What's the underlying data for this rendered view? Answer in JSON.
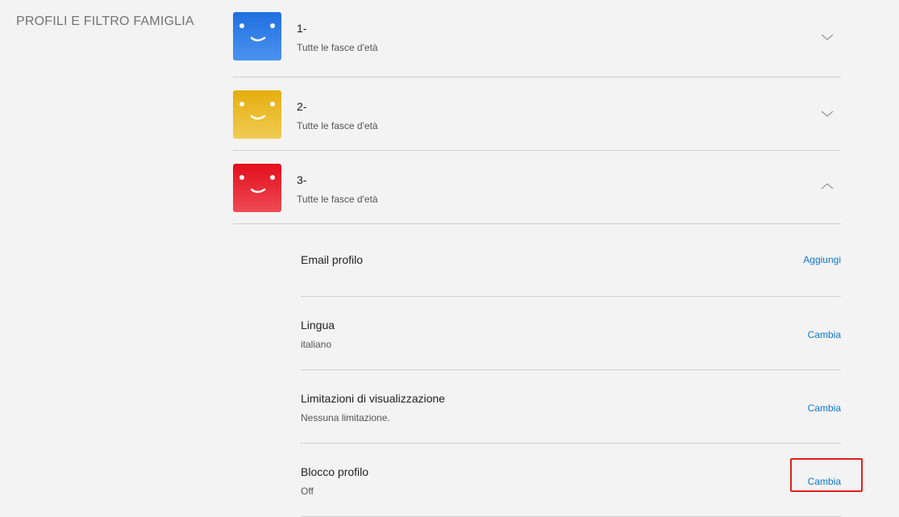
{
  "section": {
    "title": "PROFILI E FILTRO FAMIGLIA"
  },
  "profiles": [
    {
      "name": "1-",
      "rating": "Tutte le fasce d'età",
      "avatar_color": "#2d7fe8",
      "expanded": false
    },
    {
      "name": "2-",
      "rating": "Tutte le fasce d'età",
      "avatar_color": "#e8b520",
      "expanded": false
    },
    {
      "name": "3-",
      "rating": "Tutte le fasce d'età",
      "avatar_color": "#e8212e",
      "expanded": true
    }
  ],
  "settings": {
    "email": {
      "label": "Email profilo",
      "action": "Aggiungi"
    },
    "language": {
      "label": "Lingua",
      "value": "italiano",
      "action": "Cambia"
    },
    "viewing": {
      "label": "Limitazioni di visualizzazione",
      "value": "Nessuna limitazione.",
      "action": "Cambia"
    },
    "lock": {
      "label": "Blocco profilo",
      "value": "Off",
      "action": "Cambia"
    }
  },
  "colors": {
    "link": "#0c76d5",
    "highlight": "#e0201a"
  }
}
